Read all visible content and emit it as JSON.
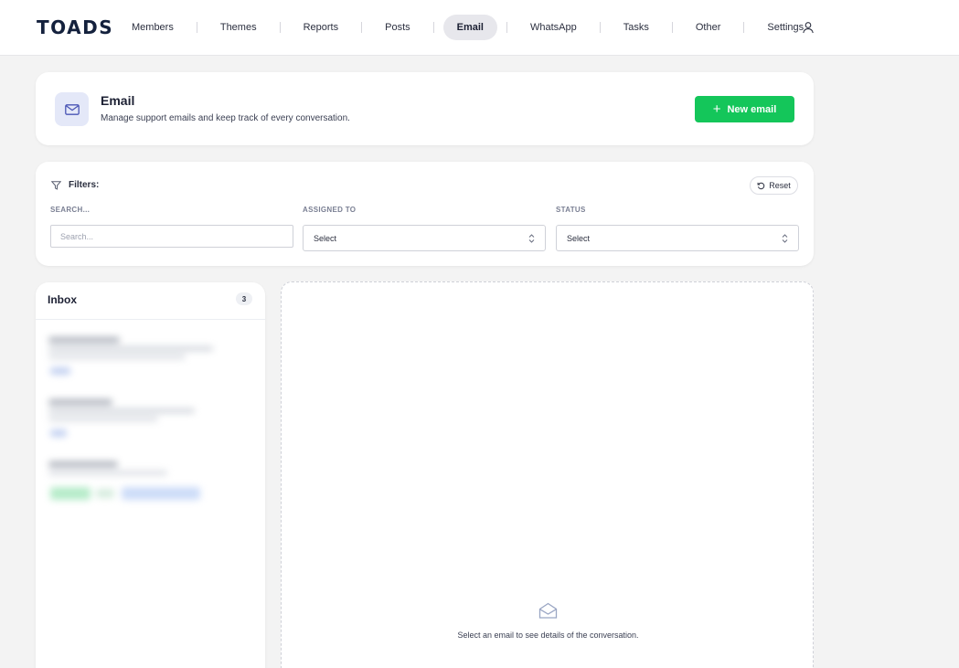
{
  "brand": {
    "logo_text": "TOADS"
  },
  "nav": {
    "items": [
      {
        "label": "Members"
      },
      {
        "label": "Themes"
      },
      {
        "label": "Reports"
      },
      {
        "label": "Posts"
      },
      {
        "label": "Email"
      },
      {
        "label": "WhatsApp"
      },
      {
        "label": "Tasks"
      },
      {
        "label": "Other"
      },
      {
        "label": "Settings"
      }
    ],
    "active": "Email",
    "user_icon": "user-icon"
  },
  "header": {
    "icon": "mail-icon",
    "title": "Email",
    "subtitle": "Manage support emails and keep track of every conversation.",
    "new_button": "New email"
  },
  "filters": {
    "title": "Filters:",
    "reset_label": "Reset",
    "search": {
      "label": "SEARCH...",
      "placeholder": "Search..."
    },
    "assigned_to": {
      "label": "ASSIGNED TO",
      "value": "Select"
    },
    "status": {
      "label": "STATUS",
      "value": "Select"
    }
  },
  "inbox": {
    "title": "Inbox",
    "count": "3"
  },
  "detail": {
    "empty_icon": "envelope-open-icon",
    "empty_text": "Select an email to see details of the conversation."
  },
  "colors": {
    "accent_green": "#14c65a",
    "brand_navy": "#14213d",
    "active_pill": "#e7e7ec",
    "background": "#f3f3f3"
  }
}
